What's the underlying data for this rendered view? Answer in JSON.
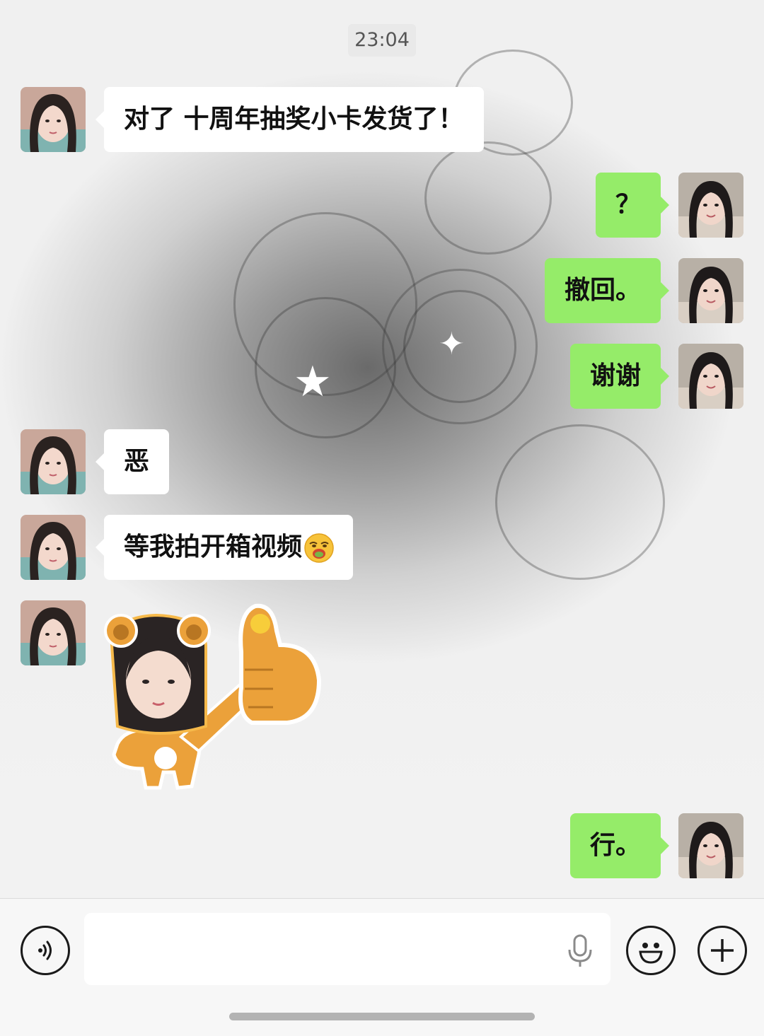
{
  "chat": {
    "timestamp": "23:04",
    "messages": [
      {
        "side": "in",
        "text": "对了 十周年抽奖小卡发货了！"
      },
      {
        "side": "out",
        "text": "？"
      },
      {
        "side": "out",
        "text": "撤回。"
      },
      {
        "side": "out",
        "text": "谢谢"
      },
      {
        "side": "in",
        "text": "恶"
      },
      {
        "side": "in",
        "text": "等我拍开箱视频",
        "emoji": "drooling-emoji"
      },
      {
        "side": "in",
        "sticker": "bear-thumbs-up-sticker"
      },
      {
        "side": "out",
        "text": "行。"
      }
    ]
  },
  "input_bar": {
    "placeholder": "",
    "value": ""
  },
  "colors": {
    "outgoing_bubble": "#95ec69",
    "incoming_bubble": "#ffffff",
    "input_bar_bg": "#f7f7f7"
  },
  "icons": [
    "voice-toggle-icon",
    "microphone-icon",
    "emoji-icon",
    "plus-icon"
  ]
}
